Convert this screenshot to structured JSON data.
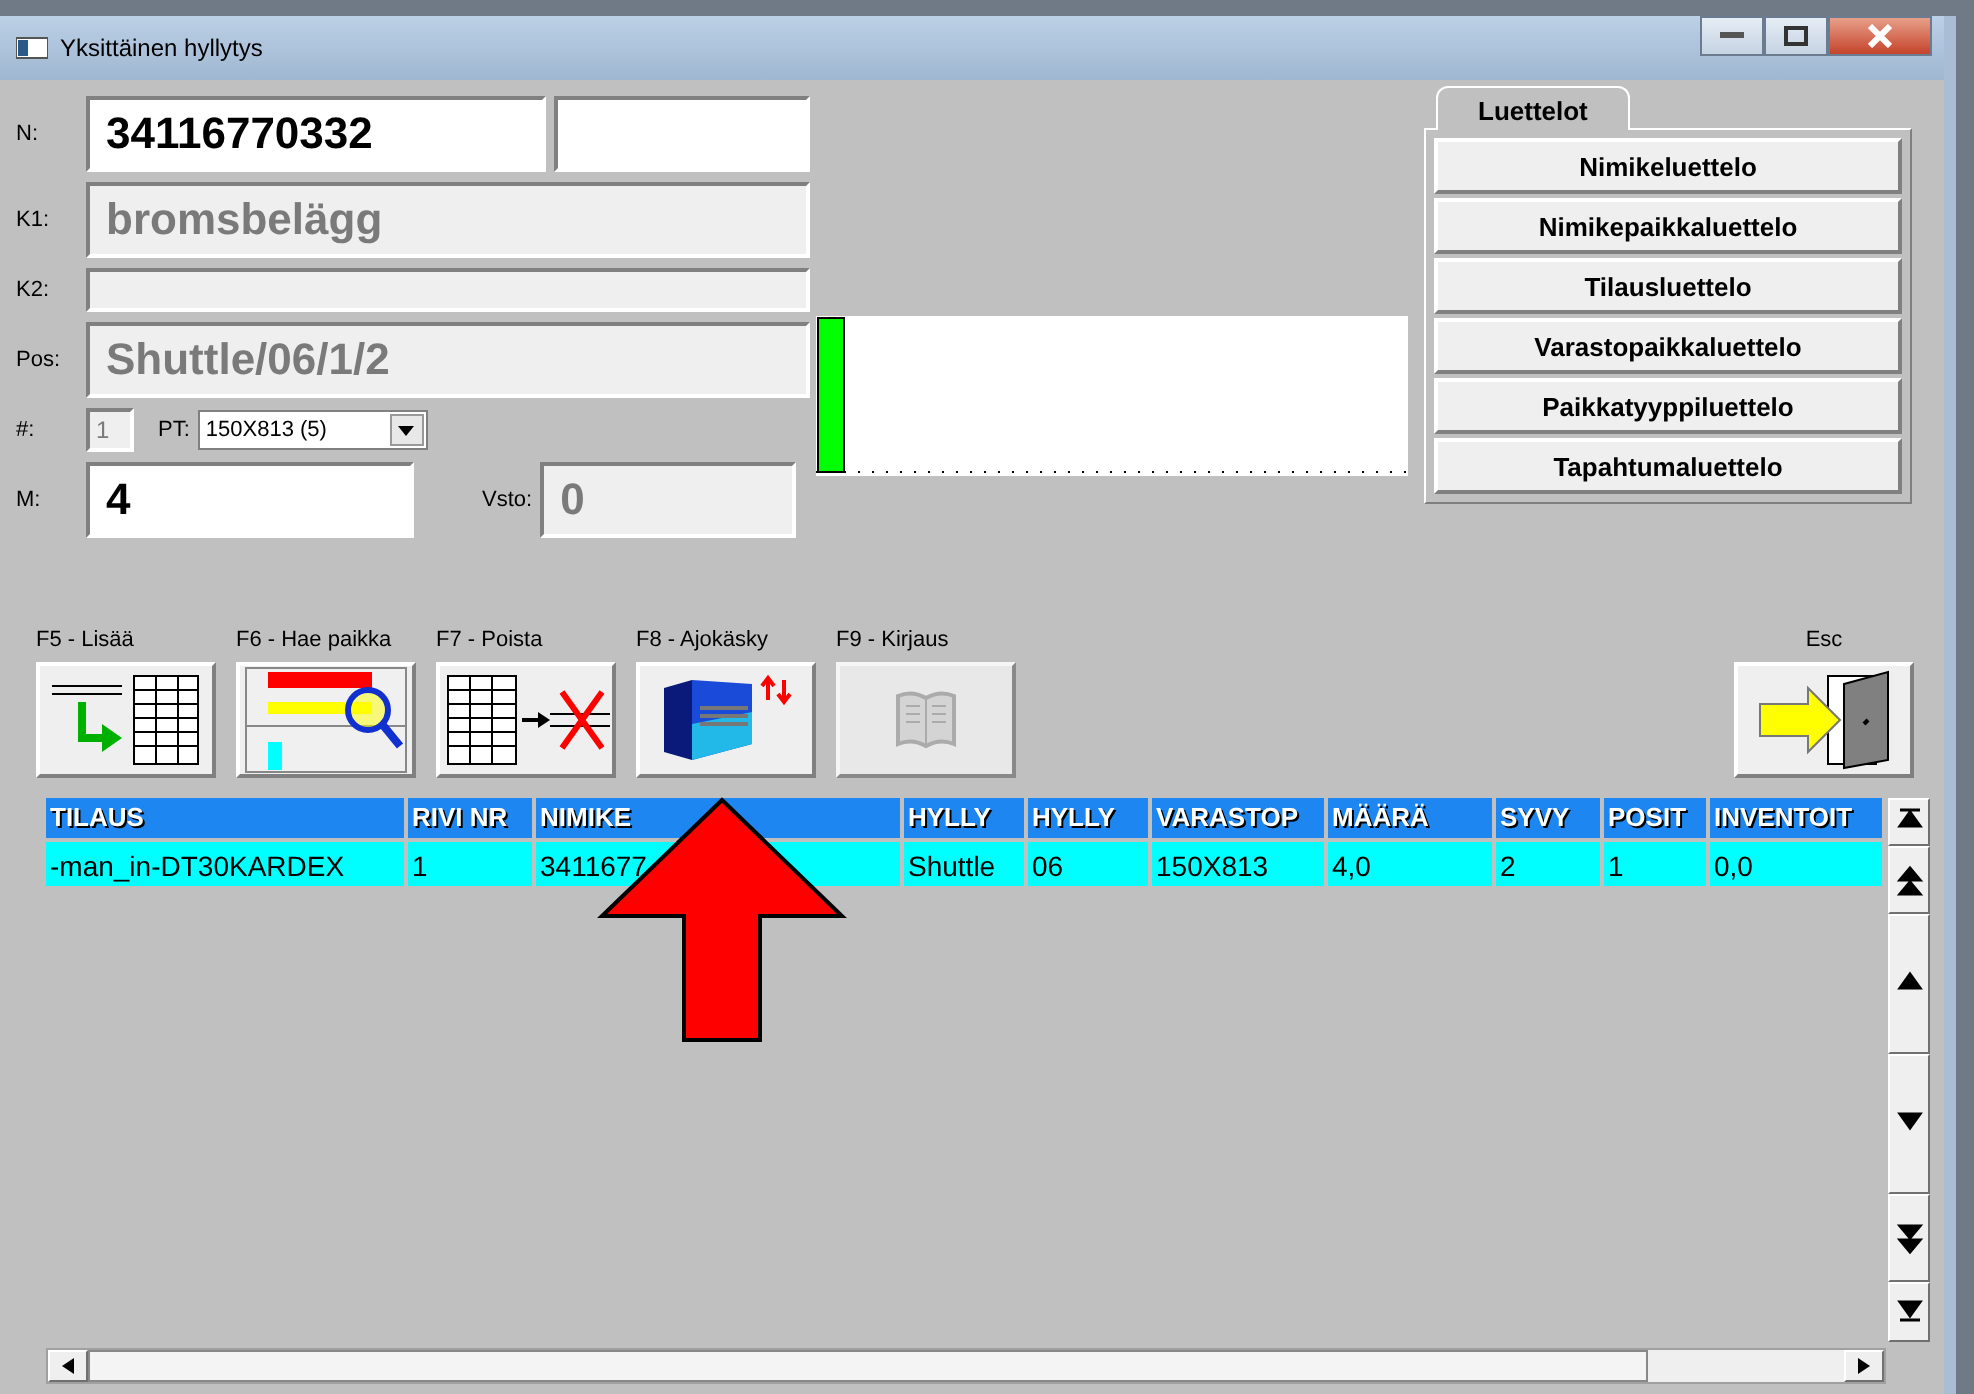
{
  "window": {
    "title": "Yksittäinen hyllytys"
  },
  "form": {
    "n": {
      "label": "N:",
      "value": "34116770332",
      "disabled": false
    },
    "n_extra": {
      "disabled": false
    },
    "k1": {
      "label": "K1:",
      "value": "bromsbelägg",
      "disabled": true
    },
    "k2": {
      "label": "K2:",
      "disabled": true
    },
    "pos": {
      "label": "Pos:",
      "value": "Shuttle/06/1/2",
      "disabled": true
    },
    "hash": {
      "label": "#:",
      "value": "1",
      "disabled": true
    },
    "pt": {
      "label": "PT:",
      "value": "150X813 (5)"
    },
    "m": {
      "label": "M:",
      "value": "4",
      "disabled": false
    },
    "vsto": {
      "label": "Vsto:",
      "value": "0",
      "disabled": true
    }
  },
  "lists_tab": {
    "label": "Luettelot",
    "buttons": [
      "Nimikeluettelo",
      "Nimikepaikkaluettelo",
      "Tilausluettelo",
      "Varastopaikkaluettelo",
      "Paikkatyyppiluettelo",
      "Tapahtumaluettelo"
    ]
  },
  "toolbar": [
    {
      "label": "F5 - Lisää",
      "kind": "add",
      "disabled": false
    },
    {
      "label": "F6 - Hae paikka",
      "kind": "find",
      "disabled": false
    },
    {
      "label": "F7 - Poista",
      "kind": "delete",
      "disabled": false
    },
    {
      "label": "F8 - Ajokäsky",
      "kind": "run",
      "disabled": false
    },
    {
      "label": "F9 - Kirjaus",
      "kind": "book",
      "disabled": true
    },
    {
      "label": "Esc",
      "kind": "exit",
      "disabled": false
    }
  ],
  "table": {
    "columns": [
      "TILAUS",
      "RIVI NR",
      "NIMIKE",
      "HYLLY",
      "HYLLY",
      "VARASTOP",
      "MÄÄRÄ",
      "SYVY",
      "POSIT",
      "INVENTOIT"
    ],
    "rows": [
      {
        "selected": true,
        "cells": [
          "-man_in-DT30KARDEX",
          "1",
          "3411677",
          "Shuttle",
          "06",
          "150X813",
          "4,0",
          "2",
          "1",
          "0,0"
        ]
      }
    ]
  }
}
